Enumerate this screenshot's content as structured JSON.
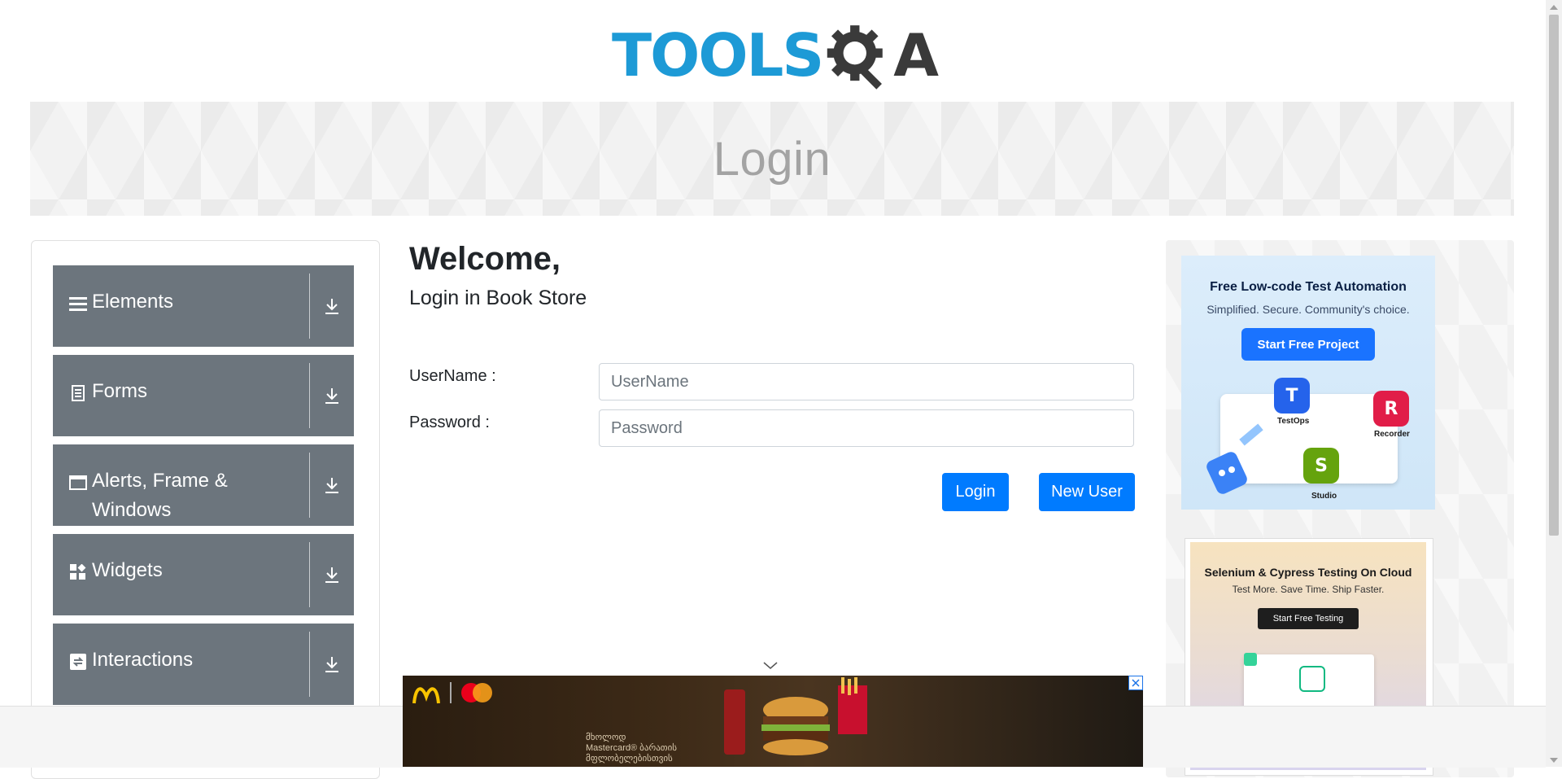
{
  "brand": {
    "logo_left": "TOOLS",
    "logo_right": "A"
  },
  "banner": {
    "title": "Login"
  },
  "sidebar": {
    "items": [
      {
        "label": "Elements",
        "icon": "list-icon"
      },
      {
        "label": "Forms",
        "icon": "document-icon"
      },
      {
        "label": "Alerts, Frame & Windows",
        "icon": "window-icon"
      },
      {
        "label": "Widgets",
        "icon": "widgets-icon"
      },
      {
        "label": "Interactions",
        "icon": "interactions-icon"
      }
    ]
  },
  "main": {
    "welcome": "Welcome,",
    "subtitle": "Login in Book Store",
    "username_label": "UserName :",
    "username_placeholder": "UserName",
    "password_label": "Password :",
    "password_placeholder": "Password",
    "login_button": "Login",
    "new_user_button": "New User"
  },
  "ads": {
    "ad1": {
      "title": "Free Low-code Test Automation",
      "subtitle": "Simplified. Secure. Community's choice.",
      "button": "Start Free Project",
      "chip_testops": "TestOps",
      "chip_recorder": "Recorder",
      "chip_studio": "Studio"
    },
    "ad2": {
      "title": "Selenium & Cypress Testing On Cloud",
      "subtitle": "Test More. Save Time. Ship Faster.",
      "button": "Start Free Testing"
    },
    "bottom": {
      "text_line1": "მხოლოდ",
      "text_line2": "Mastercard® ბარათის",
      "text_line3": "მფლობელებისთვის"
    }
  },
  "colors": {
    "brand_blue": "#1d9ad6",
    "sidebar_gray": "#6c757d",
    "button_blue": "#007bff"
  }
}
